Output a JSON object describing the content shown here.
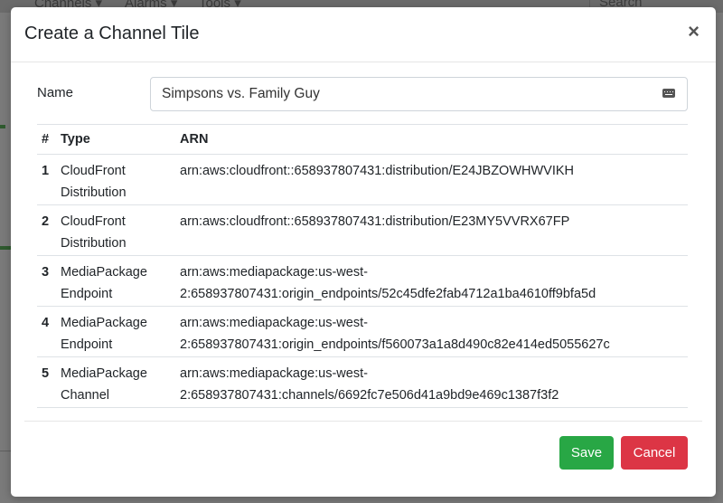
{
  "background": {
    "nav": [
      "Channels",
      "Alarms",
      "Tools"
    ],
    "search_placeholder": "Search"
  },
  "modal": {
    "title": "Create a Channel Tile",
    "close_glyph": "×",
    "name_label": "Name",
    "name_value": "Simpsons vs. Family Guy",
    "table": {
      "headers": [
        "#",
        "Type",
        "ARN"
      ],
      "rows": [
        {
          "index": "1",
          "type": "CloudFront Distribution",
          "arn": "arn:aws:cloudfront::658937807431:distribution/E24JBZOWHWVIKH"
        },
        {
          "index": "2",
          "type": "CloudFront Distribution",
          "arn": "arn:aws:cloudfront::658937807431:distribution/E23MY5VVRX67FP"
        },
        {
          "index": "3",
          "type": "MediaPackage Endpoint",
          "arn": "arn:aws:mediapackage:us-west-2:658937807431:origin_endpoints/52c45dfe2fab4712a1ba4610ff9bfa5d"
        },
        {
          "index": "4",
          "type": "MediaPackage Endpoint",
          "arn": "arn:aws:mediapackage:us-west-2:658937807431:origin_endpoints/f560073a1a8d490c82e414ed5055627c"
        },
        {
          "index": "5",
          "type": "MediaPackage Channel",
          "arn": "arn:aws:mediapackage:us-west-2:658937807431:channels/6692fc7e506d41a9bd9e469c1387f3f2"
        }
      ]
    },
    "buttons": {
      "save": "Save",
      "cancel": "Cancel"
    }
  },
  "colors": {
    "save": "#28a745",
    "cancel": "#dc3545"
  }
}
